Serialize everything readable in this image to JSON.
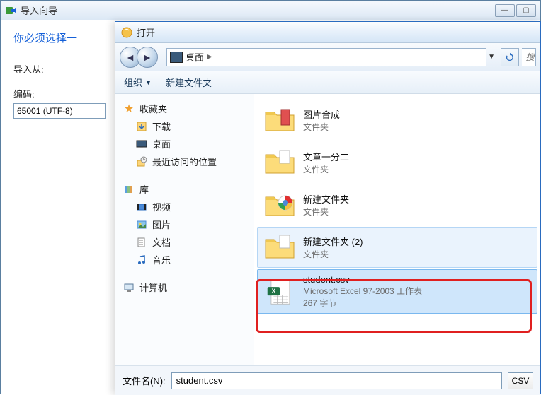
{
  "import": {
    "title": "导入向导",
    "heading": "你必须选择一",
    "from_label": "导入从:",
    "encoding_label": "编码:",
    "encoding_value": "65001 (UTF-8)"
  },
  "dialog": {
    "title": "打开",
    "breadcrumb": {
      "location": "桌面"
    },
    "search_placeholder": "搜",
    "toolbar": {
      "organize": "组织",
      "new_folder": "新建文件夹"
    },
    "sidebar": {
      "favorites": {
        "label": "收藏夹",
        "items": [
          {
            "label": "下载"
          },
          {
            "label": "桌面"
          },
          {
            "label": "最近访问的位置"
          }
        ]
      },
      "libraries": {
        "label": "库",
        "items": [
          {
            "label": "视频"
          },
          {
            "label": "图片"
          },
          {
            "label": "文档"
          },
          {
            "label": "音乐"
          }
        ]
      },
      "computer": {
        "label": "计算机"
      }
    },
    "files": [
      {
        "name": "图片合成",
        "type": "文件夹"
      },
      {
        "name": "文章一分二",
        "type": "文件夹"
      },
      {
        "name": "新建文件夹",
        "type": "文件夹"
      },
      {
        "name": "新建文件夹 (2)",
        "type": "文件夹"
      },
      {
        "name": "student.csv",
        "type": "Microsoft Excel 97-2003 工作表",
        "size": "267 字节"
      }
    ],
    "filename_label": "文件名(N):",
    "filename_value": "student.csv",
    "filter_label": "CSV"
  }
}
